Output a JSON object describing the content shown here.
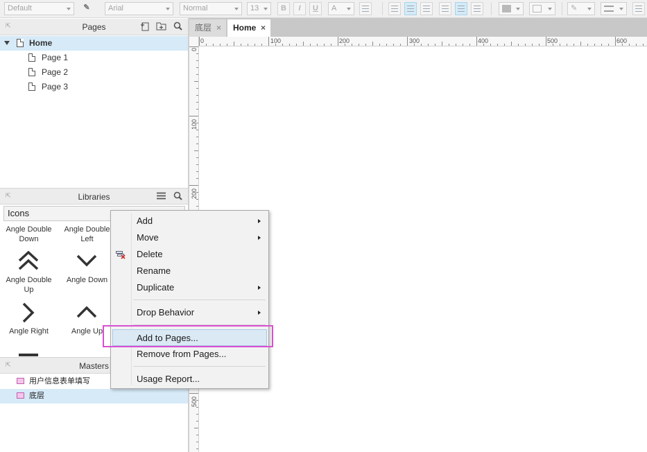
{
  "toolbar": {
    "style_select": "Default",
    "font_select": "Arial",
    "weight_select": "Normal",
    "size_select": "13",
    "bold": "B",
    "italic": "I",
    "underline": "U",
    "font_color": "A"
  },
  "pages_panel": {
    "title": "Pages",
    "items": [
      {
        "label": "Home"
      },
      {
        "label": "Page 1"
      },
      {
        "label": "Page 2"
      },
      {
        "label": "Page 3"
      }
    ]
  },
  "libraries_panel": {
    "title": "Libraries",
    "search_value": "Icons",
    "items": [
      {
        "label": "Angle Double Down",
        "line1": "Angle Double",
        "line2": "Down"
      },
      {
        "label": "Angle Double Left",
        "line1": "Angle Double",
        "line2": "Left"
      },
      {
        "label": "Angle Double Up"
      },
      {
        "label": "Angle Down"
      },
      {
        "label": "Angle Right"
      },
      {
        "label": "Angle Up"
      }
    ]
  },
  "masters_panel": {
    "title": "Masters",
    "items": [
      {
        "label": "用户信息表单填写"
      },
      {
        "label": "底层"
      }
    ]
  },
  "tabs": [
    {
      "label": "底层",
      "close": "×"
    },
    {
      "label": "Home",
      "close": "×"
    }
  ],
  "ruler": {
    "h_labels": [
      "0",
      "100",
      "200",
      "300",
      "400",
      "500",
      "600"
    ],
    "v_labels": [
      "0",
      "100",
      "200",
      "500"
    ]
  },
  "context_menu": {
    "items": [
      {
        "label": "Add",
        "submenu": true
      },
      {
        "label": "Move",
        "submenu": true
      },
      {
        "label": "Delete",
        "submenu": false
      },
      {
        "label": "Rename",
        "submenu": false
      },
      {
        "label": "Duplicate",
        "submenu": true
      },
      {
        "label": "Drop Behavior",
        "submenu": true
      },
      {
        "label": "Add to Pages...",
        "submenu": false
      },
      {
        "label": "Remove from Pages...",
        "submenu": false
      },
      {
        "label": "Usage Report...",
        "submenu": false
      }
    ],
    "highlighted_item": "Add to Pages...",
    "highlight_color": "#d84fd2"
  },
  "colors": {
    "selection": "#d6eaf8",
    "menu_hover": "#dbe9f5",
    "master_icon": "#f4c6ea"
  }
}
